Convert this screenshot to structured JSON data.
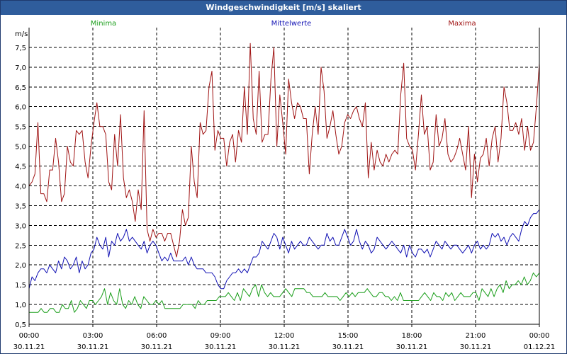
{
  "window": {
    "title": "Windgeschwindigkeit [m/s] skaliert"
  },
  "chart_data": {
    "type": "line",
    "title": "Windgeschwindigkeit [m/s] skaliert",
    "ylabel": "m/s",
    "xlabel": "",
    "ylim": [
      0.5,
      8.0
    ],
    "yticks": [
      "0,5",
      "1,0",
      "1,5",
      "2,0",
      "2,5",
      "3,0",
      "3,5",
      "4,0",
      "4,5",
      "5,0",
      "5,5",
      "6,0",
      "6,5",
      "7,0",
      "7,5"
    ],
    "ytick_values": [
      0.5,
      1.0,
      1.5,
      2.0,
      2.5,
      3.0,
      3.5,
      4.0,
      4.5,
      5.0,
      5.5,
      6.0,
      6.5,
      7.0,
      7.5
    ],
    "xticks": [
      {
        "time": "00:00",
        "date": "30.11.21"
      },
      {
        "time": "03:00",
        "date": "30.11.21"
      },
      {
        "time": "06:00",
        "date": "30.11.21"
      },
      {
        "time": "09:00",
        "date": "30.11.21"
      },
      {
        "time": "12:00",
        "date": "30.11.21"
      },
      {
        "time": "15:00",
        "date": "30.11.21"
      },
      {
        "time": "18:00",
        "date": "30.11.21"
      },
      {
        "time": "21:00",
        "date": "30.11.21"
      },
      {
        "time": "00:00",
        "date": "01.12.21"
      }
    ],
    "grid": true,
    "legend": "top",
    "series": [
      {
        "name": "Minima",
        "color": "#1a9e1a",
        "values": [
          0.8,
          0.8,
          0.8,
          0.8,
          0.9,
          0.8,
          0.8,
          0.9,
          0.9,
          0.8,
          0.8,
          1.0,
          0.9,
          0.9,
          1.1,
          0.8,
          0.9,
          1.1,
          1.0,
          0.9,
          1.1,
          1.1,
          1.0,
          1.1,
          1.2,
          1.4,
          1.0,
          1.3,
          1.1,
          1.0,
          1.4,
          1.0,
          0.9,
          1.1,
          1.0,
          1.2,
          1.0,
          0.9,
          1.2,
          1.1,
          1.0,
          1.0,
          1.1,
          1.0,
          1.1,
          0.9,
          0.9,
          0.9,
          0.9,
          0.9,
          0.9,
          1.0,
          1.0,
          1.0,
          1.0,
          0.9,
          1.1,
          1.0,
          1.0,
          1.1,
          1.1,
          1.1,
          1.1,
          1.2,
          1.2,
          1.2,
          1.3,
          1.2,
          1.1,
          1.3,
          1.1,
          1.4,
          1.3,
          1.2,
          1.4,
          1.5,
          1.2,
          1.5,
          1.3,
          1.2,
          1.3,
          1.2,
          1.2,
          1.2,
          1.3,
          1.4,
          1.3,
          1.2,
          1.4,
          1.4,
          1.4,
          1.4,
          1.3,
          1.3,
          1.2,
          1.2,
          1.2,
          1.2,
          1.3,
          1.2,
          1.2,
          1.2,
          1.2,
          1.1,
          1.2,
          1.3,
          1.2,
          1.3,
          1.2,
          1.3,
          1.3,
          1.3,
          1.4,
          1.3,
          1.2,
          1.2,
          1.3,
          1.3,
          1.2,
          1.2,
          1.1,
          1.2,
          1.1,
          1.3,
          1.1,
          1.1,
          1.1,
          1.1,
          1.1,
          1.1,
          1.2,
          1.3,
          1.2,
          1.1,
          1.3,
          1.2,
          1.2,
          1.1,
          1.3,
          1.2,
          1.3,
          1.1,
          1.2,
          1.3,
          1.2,
          1.2,
          1.2,
          1.3,
          1.3,
          1.1,
          1.4,
          1.3,
          1.2,
          1.4,
          1.2,
          1.4,
          1.5,
          1.3,
          1.6,
          1.4,
          1.5,
          1.5,
          1.6,
          1.5,
          1.7,
          1.5,
          1.6,
          1.8,
          1.7,
          1.8
        ]
      },
      {
        "name": "Mittelwerte",
        "color": "#1212b4",
        "values": [
          1.4,
          1.7,
          1.6,
          1.8,
          1.9,
          1.9,
          1.8,
          2.0,
          1.9,
          1.8,
          2.1,
          1.9,
          2.2,
          2.1,
          1.9,
          2.0,
          2.2,
          1.8,
          2.1,
          1.9,
          2.0,
          2.3,
          2.4,
          2.7,
          2.5,
          2.4,
          2.7,
          2.2,
          2.6,
          2.5,
          2.8,
          2.6,
          2.7,
          2.9,
          2.6,
          2.7,
          2.6,
          2.5,
          2.4,
          2.6,
          2.3,
          2.5,
          2.6,
          2.5,
          2.3,
          2.1,
          2.2,
          2.1,
          2.3,
          2.1,
          2.1,
          2.1,
          2.1,
          2.2,
          2.0,
          2.2,
          2.0,
          1.9,
          1.9,
          1.9,
          1.8,
          1.8,
          1.8,
          1.7,
          1.5,
          1.4,
          1.4,
          1.6,
          1.7,
          1.8,
          1.8,
          1.9,
          1.8,
          1.9,
          1.8,
          2.0,
          2.2,
          2.2,
          2.3,
          2.6,
          2.5,
          2.4,
          2.6,
          2.8,
          2.7,
          2.4,
          2.7,
          2.5,
          2.3,
          2.6,
          2.4,
          2.5,
          2.6,
          2.5,
          2.5,
          2.7,
          2.6,
          2.5,
          2.4,
          2.5,
          2.5,
          2.8,
          2.6,
          2.7,
          2.5,
          2.5,
          2.7,
          2.9,
          2.7,
          2.5,
          2.6,
          2.9,
          2.6,
          2.4,
          2.6,
          2.5,
          2.3,
          2.4,
          2.7,
          2.6,
          2.5,
          2.4,
          2.5,
          2.6,
          2.5,
          2.4,
          2.3,
          2.5,
          2.2,
          2.5,
          2.3,
          2.2,
          2.4,
          2.4,
          2.3,
          2.4,
          2.2,
          2.4,
          2.6,
          2.5,
          2.4,
          2.6,
          2.5,
          2.4,
          2.5,
          2.5,
          2.4,
          2.3,
          2.4,
          2.5,
          2.3,
          2.5,
          2.6,
          2.4,
          2.5,
          2.4,
          2.5,
          2.8,
          2.7,
          2.8,
          2.6,
          2.7,
          2.5,
          2.7,
          2.8,
          2.7,
          2.6,
          2.9,
          3.1,
          3.0,
          3.2,
          3.3,
          3.3,
          3.4
        ]
      },
      {
        "name": "Maxima",
        "color": "#a01414",
        "values": [
          4.0,
          4.1,
          4.3,
          5.6,
          3.8,
          3.8,
          3.6,
          4.4,
          4.4,
          5.2,
          4.6,
          3.6,
          3.8,
          5.0,
          4.6,
          4.5,
          5.4,
          5.3,
          5.4,
          4.6,
          4.2,
          5.0,
          5.6,
          6.1,
          5.5,
          5.5,
          5.3,
          4.1,
          3.9,
          5.3,
          4.5,
          5.8,
          4.2,
          3.7,
          3.9,
          3.6,
          3.1,
          3.9,
          3.4,
          5.9,
          2.9,
          2.6,
          2.9,
          2.7,
          2.8,
          2.8,
          2.6,
          2.8,
          2.8,
          2.5,
          2.2,
          2.6,
          3.4,
          3.0,
          3.2,
          5.0,
          4.1,
          3.7,
          5.6,
          5.3,
          5.4,
          6.5,
          6.9,
          4.9,
          5.4,
          5.2,
          5.2,
          4.5,
          5.1,
          5.3,
          4.6,
          5.4,
          5.1,
          6.5,
          5.3,
          7.6,
          5.7,
          5.3,
          6.9,
          5.1,
          5.3,
          5.3,
          6.7,
          7.5,
          5.0,
          6.3,
          5.6,
          4.8,
          6.7,
          6.1,
          5.7,
          6.1,
          6.0,
          5.7,
          5.7,
          4.3,
          5.3,
          6.0,
          5.3,
          7.0,
          6.4,
          5.2,
          5.5,
          5.9,
          5.3,
          4.8,
          5.0,
          5.6,
          5.8,
          5.7,
          5.9,
          6.0,
          5.7,
          5.5,
          6.1,
          4.2,
          5.1,
          4.4,
          4.9,
          4.6,
          4.5,
          4.8,
          4.6,
          4.8,
          4.9,
          4.8,
          6.3,
          7.1,
          5.2,
          5.0,
          4.9,
          4.4,
          5.3,
          6.3,
          5.3,
          5.5,
          4.4,
          4.6,
          5.8,
          5.0,
          5.2,
          5.7,
          4.8,
          4.6,
          4.7,
          4.9,
          5.2,
          4.8,
          4.4,
          5.5,
          3.7,
          4.8,
          4.1,
          4.7,
          4.8,
          5.2,
          4.5,
          5.2,
          5.5,
          4.6,
          5.2,
          6.5,
          6.1,
          5.4,
          5.4,
          5.6,
          5.3,
          5.7,
          4.9,
          5.5,
          4.9,
          5.1,
          6.0,
          7.1
        ]
      }
    ]
  }
}
